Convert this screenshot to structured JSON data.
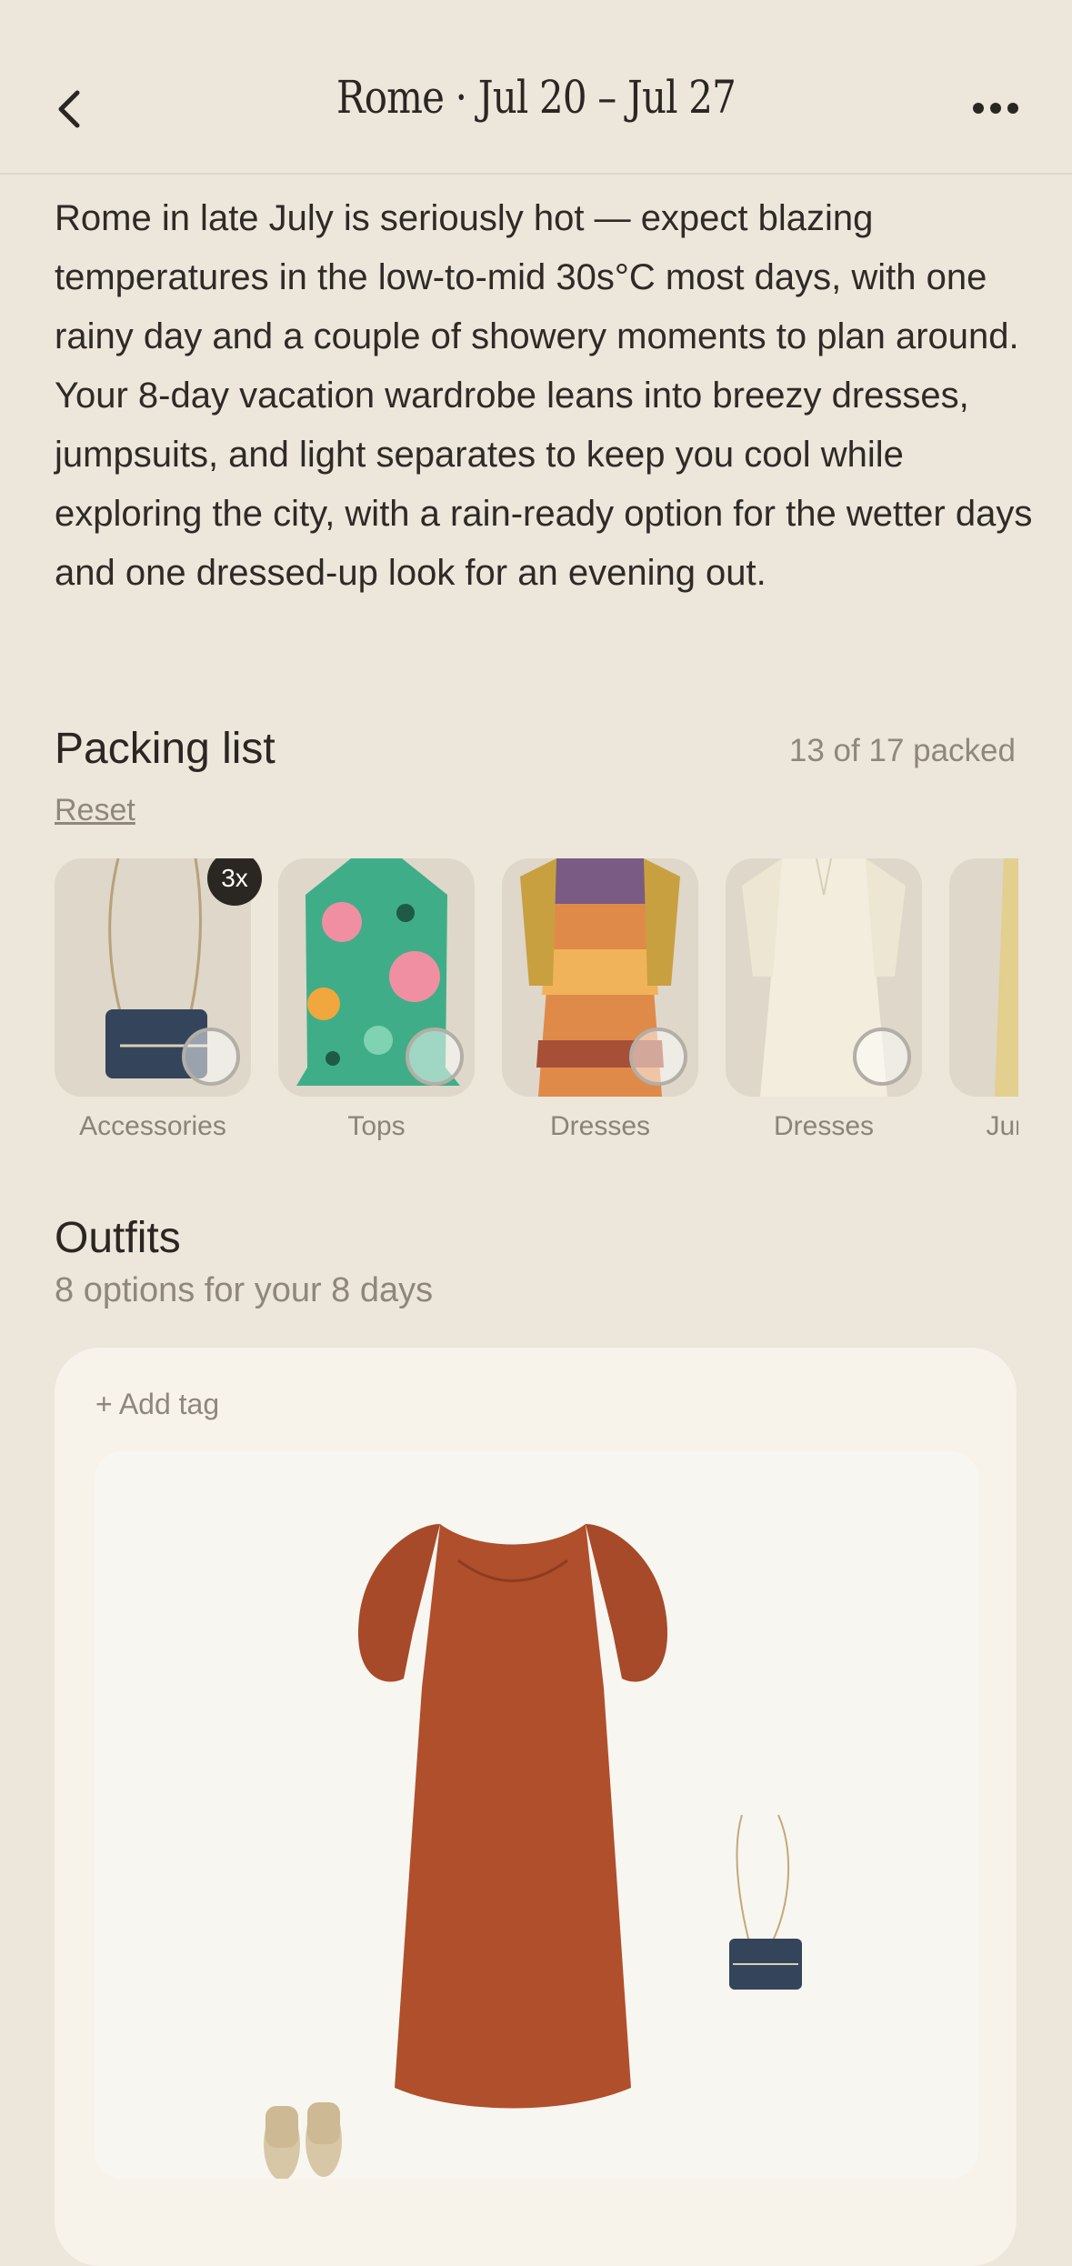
{
  "header": {
    "title": "Rome · Jul 20 – Jul 27",
    "back_icon": "chevron-left-icon",
    "more_icon": "more-horizontal-icon"
  },
  "summary": "Rome in late July is seriously hot — expect blazing temperatures in the low-to-mid 30s°C most days, with one rainy day and a couple of showery moments to plan around. Your 8-day vacation wardrobe leans into breezy dresses, jumpsuits, and light separates to keep you cool while exploring the city, with a rain-ready option for the wetter days and one dressed-up look for an evening out.",
  "packing": {
    "title": "Packing list",
    "count": "13 of 17 packed",
    "packed": 13,
    "total": 17,
    "reset_label": "Reset",
    "items": [
      {
        "label": "Accessories",
        "badge": "3x",
        "image": "navy crossbody bag"
      },
      {
        "label": "Tops",
        "image": "green patterned top"
      },
      {
        "label": "Dresses",
        "image": "sunset print maxi dress"
      },
      {
        "label": "Dresses",
        "image": "cream linen dress"
      },
      {
        "label": "Jumpsuits",
        "image": "yellow jumpsuit"
      }
    ]
  },
  "outfits": {
    "title": "Outfits",
    "subtitle": "8 options for your 8 days",
    "add_tag_label": "+ Add tag",
    "card_items": [
      "rust maxi dress",
      "navy crossbody bag",
      "woven sandals"
    ]
  },
  "colors": {
    "background": "#ece6db",
    "card": "#f7f3ea",
    "text": "#2a2622",
    "muted": "#8f877c"
  }
}
